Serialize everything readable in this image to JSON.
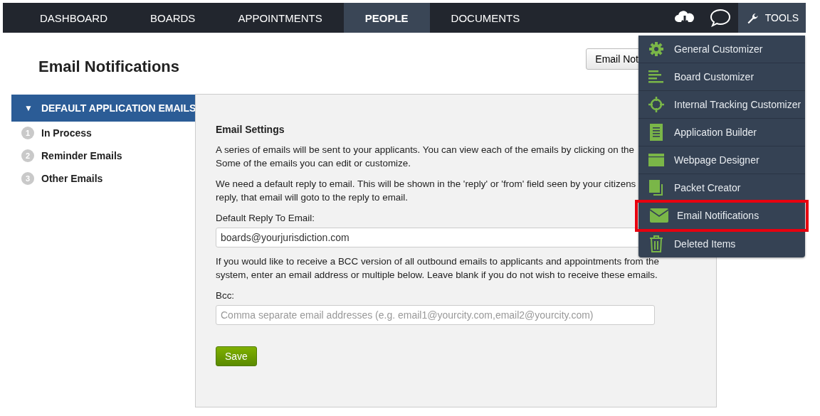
{
  "nav": {
    "tabs": [
      {
        "label": "DASHBOARD",
        "selected": false
      },
      {
        "label": "BOARDS",
        "selected": false
      },
      {
        "label": "APPOINTMENTS",
        "selected": false
      },
      {
        "label": "PEOPLE",
        "selected": true
      },
      {
        "label": "DOCUMENTS",
        "selected": false
      }
    ],
    "tools": {
      "label": "TOOLS",
      "expanded": true
    }
  },
  "tools_menu": [
    {
      "label": "General Customizer",
      "highlighted": false
    },
    {
      "label": "Board Customizer",
      "highlighted": false
    },
    {
      "label": "Internal Tracking Customizer",
      "highlighted": false
    },
    {
      "label": "Application Builder",
      "highlighted": false
    },
    {
      "label": "Webpage Designer",
      "highlighted": false
    },
    {
      "label": "Packet Creator",
      "highlighted": false
    },
    {
      "label": "Email Notifications",
      "highlighted": true
    },
    {
      "label": "Deleted Items",
      "highlighted": false
    }
  ],
  "page_title": "Email Notifications",
  "header_button": "Email Not",
  "sidebar": {
    "section": {
      "toggle": "▼",
      "label": "DEFAULT APPLICATION EMAILS",
      "expanded": true
    },
    "items": [
      {
        "number": "1",
        "label": "In Process"
      },
      {
        "number": "2",
        "label": "Reminder Emails"
      },
      {
        "number": "3",
        "label": "Other Emails"
      }
    ]
  },
  "panel": {
    "heading": "Email Settings",
    "intro": [
      [
        "A series of emails will be sent to your applicants. You can view each of the emails by clicking on the",
        "Some of the emails you can edit or customize."
      ],
      [
        "We need a default reply to email. This will be shown in the 'reply' or 'from' field seen by your citizens",
        "reply, that email will goto to the reply to email."
      ]
    ],
    "reply_field": {
      "label": "Default Reply To Email:",
      "value": "boards@yourjurisdiction.com"
    },
    "bcc_note": [
      "If you would like to receive a BCC version of all outbound emails to applicants and appointments from the",
      "system, enter an email address or multiple below. Leave blank if you do not wish to receive these emails."
    ],
    "bcc_field": {
      "label": "Bcc:",
      "placeholder": "Comma separate email addresses (e.g. email1@yourcity.com,email2@yourcity.com)"
    },
    "save_button": "Save"
  }
}
